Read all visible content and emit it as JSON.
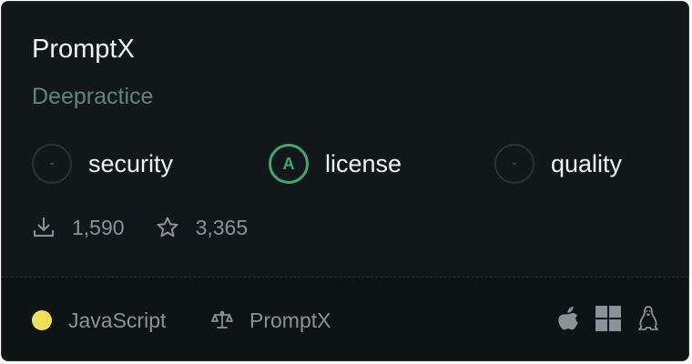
{
  "package": {
    "name": "PromptX",
    "author": "Deepractice"
  },
  "scores": [
    {
      "label": "security",
      "grade": "-",
      "icon": "dash-circle-icon"
    },
    {
      "label": "license",
      "grade": "A",
      "icon": "grade-a-circle-icon",
      "color": "#3aa872"
    },
    {
      "label": "quality",
      "grade": "-",
      "icon": "dash-circle-icon"
    }
  ],
  "stats": {
    "downloads": "1,590",
    "stars": "3,365",
    "download_icon": "download-icon",
    "star_icon": "star-icon"
  },
  "footer": {
    "language": "JavaScript",
    "language_color": "#f1e05a",
    "license": "PromptX",
    "license_icon": "scale-icon",
    "platforms": [
      "apple-icon",
      "windows-icon",
      "linux-icon"
    ]
  }
}
